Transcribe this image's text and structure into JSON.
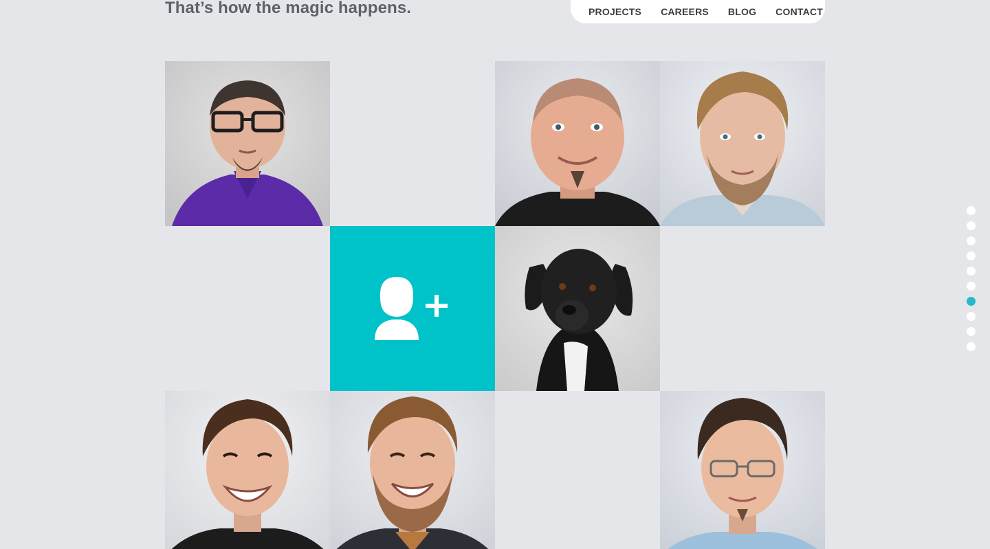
{
  "header": {
    "headline": "That’s how the magic happens."
  },
  "nav": {
    "links": [
      "PROJECTS",
      "CAREERS",
      "BLOG",
      "CONTACT"
    ]
  },
  "team_grid": {
    "add_member_icon": "add-user-icon",
    "accent_color": "#00c2c9"
  },
  "dot_nav": {
    "count": 10,
    "active_index": 6,
    "active_color": "#26b9c8"
  }
}
